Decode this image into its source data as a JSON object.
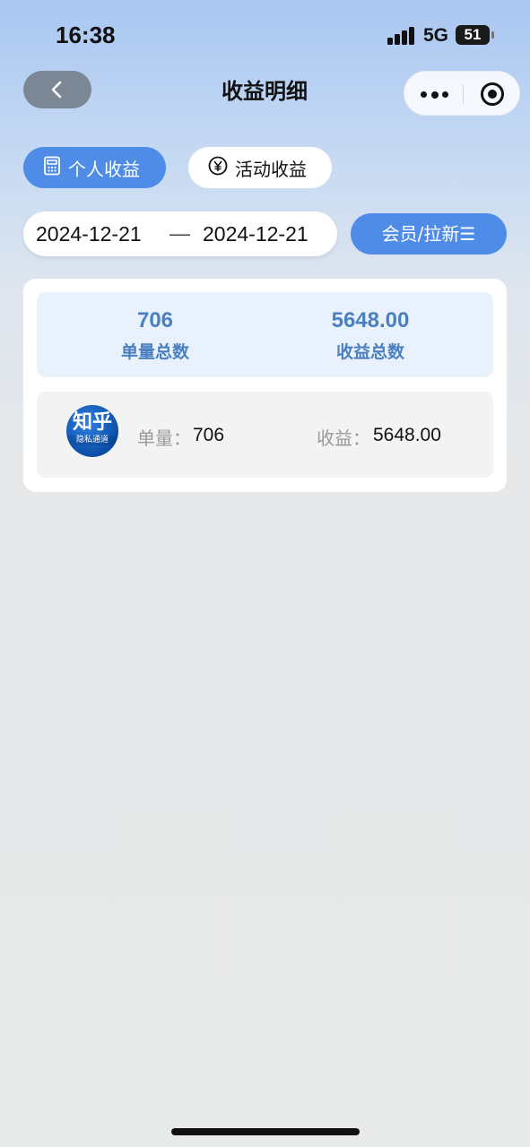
{
  "status_bar": {
    "time": "16:38",
    "network": "5G",
    "battery": "51"
  },
  "nav": {
    "title": "收益明细"
  },
  "tabs": [
    {
      "label": "个人收益",
      "icon": "calculator-icon",
      "active": true
    },
    {
      "label": "活动收益",
      "icon": "yen-circle-icon",
      "active": false
    }
  ],
  "date_range": {
    "start": "2024-12-21",
    "separator": "—",
    "end": "2024-12-21"
  },
  "filter": {
    "label": "会员/拉新☰"
  },
  "summary": {
    "count_value": "706",
    "count_label": "单量总数",
    "income_value": "5648.00",
    "income_label": "收益总数"
  },
  "detail": {
    "logo_main": "知乎",
    "logo_sub": "隐私通道",
    "count_label": "单量：",
    "count_value": "706",
    "income_label": "收益：",
    "income_value": "5648.00"
  },
  "colors": {
    "accent": "#4f8ce8",
    "summary_text": "#4a7fc0",
    "summary_bg": "#e9f1fd"
  }
}
